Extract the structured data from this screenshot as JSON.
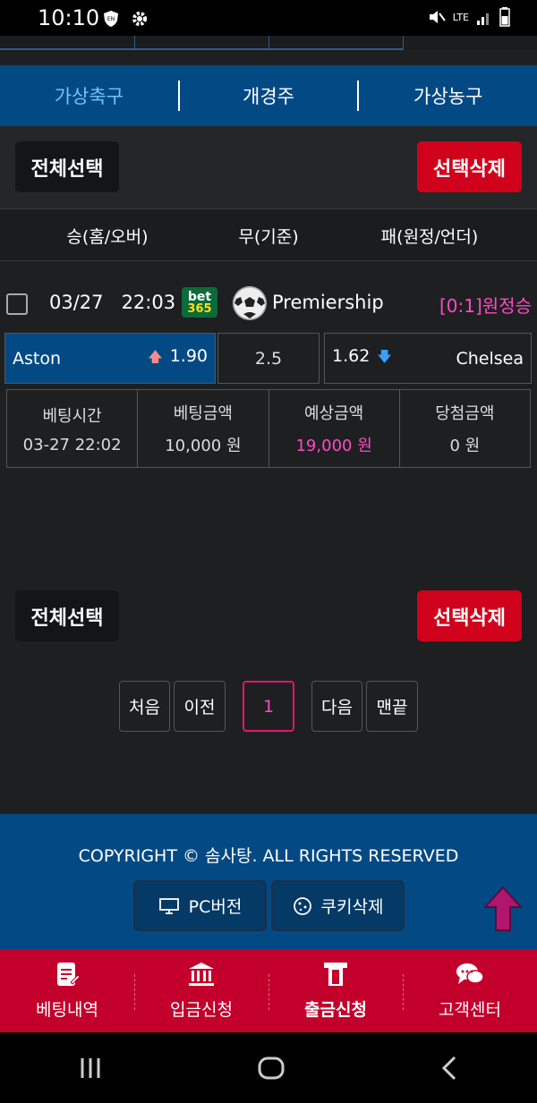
{
  "status": {
    "time": "10:10",
    "network": "LTE"
  },
  "sport_tabs": [
    {
      "label": "가상축구",
      "active": true
    },
    {
      "label": "개경주",
      "active": false
    },
    {
      "label": "가상농구",
      "active": false
    }
  ],
  "actions": {
    "select_all": "전체선택",
    "delete_selected": "선택삭제"
  },
  "columns": {
    "home": "승(홈/오버)",
    "draw": "무(기준)",
    "away": "패(원정/언더)"
  },
  "bet": {
    "date": "03/27",
    "time": "22:03",
    "bookmaker_logo_top": "bet",
    "bookmaker_logo_bottom": "365",
    "league": "Premiership",
    "result": "[0:1]원정승",
    "home_team": "Aston",
    "home_odds": "1.90",
    "draw_value": "2.5",
    "away_odds": "1.62",
    "away_team": "Chelsea",
    "info": {
      "bet_time_label": "베팅시간",
      "bet_time": "03-27 22:02",
      "bet_amount_label": "베팅금액",
      "bet_amount": "10,000 원",
      "expected_label": "예상금액",
      "expected": "19,000 원",
      "win_label": "당첨금액",
      "win": "0 원"
    }
  },
  "pager": {
    "first": "처음",
    "prev": "이전",
    "current": "1",
    "next": "다음",
    "last": "맨끝"
  },
  "footer": {
    "copyright": "COPYRIGHT © 솜사탕. ALL RIGHTS RESERVED",
    "pc_version": "PC버전",
    "delete_cookie": "쿠키삭제"
  },
  "bottom_nav": [
    {
      "label": "베팅내역",
      "icon": "document-icon"
    },
    {
      "label": "입금신청",
      "icon": "bank-icon"
    },
    {
      "label": "출금신청",
      "icon": "atm-icon"
    },
    {
      "label": "고객센터",
      "icon": "chat-icon"
    }
  ],
  "colors": {
    "primary_blue": "#034a85",
    "red": "#d0021b",
    "pink": "#ff49c6",
    "nav_red": "#c3002c"
  }
}
